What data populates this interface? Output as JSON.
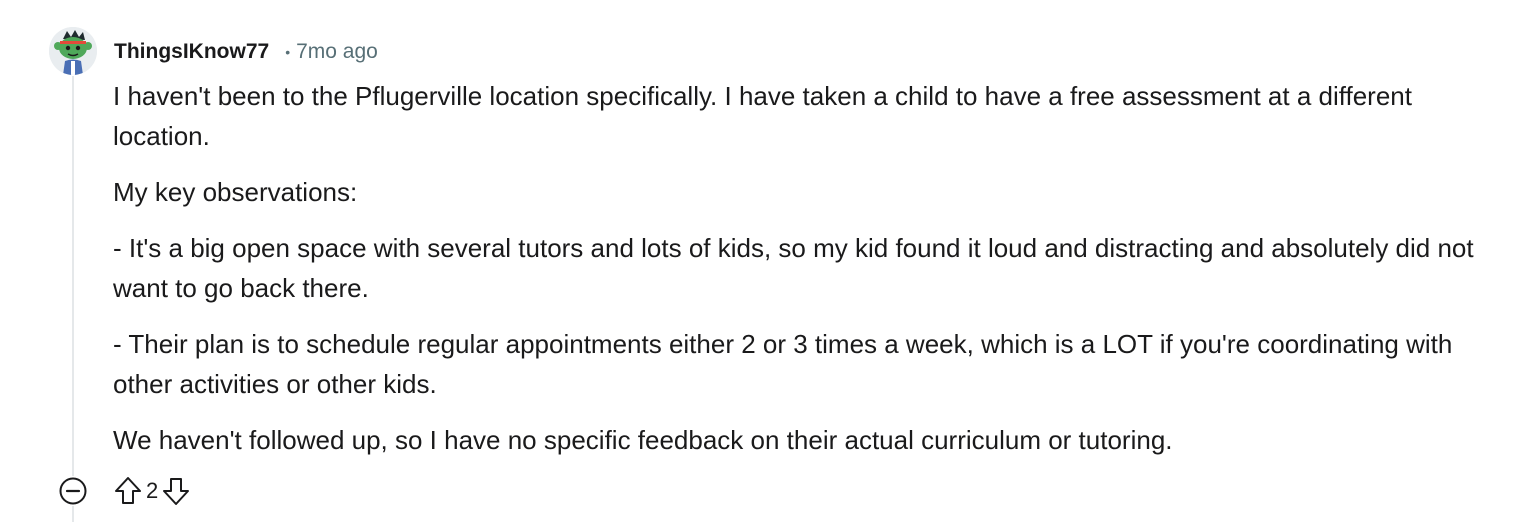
{
  "comment": {
    "author": "ThingsIKnow77",
    "separator": "•",
    "timestamp": "7mo ago",
    "paragraphs": [
      "I haven't been to the Pflugerville location specifically. I have taken a child to have a free assessment at a different location.",
      "My key observations:",
      "- It's a big open space with several tutors and lots of kids, so my kid found it loud and distracting and absolutely did not want to go back there.",
      "- Their plan is to schedule regular appointments either 2 or 3 times a week, which is a LOT if you're coordinating with other activities or other kids.",
      "We haven't followed up, so I have no specific feedback on their actual curriculum or tutoring."
    ],
    "score": "2"
  },
  "icons": {
    "avatar": "snoo-avatar",
    "collapse": "minus-circle-icon",
    "upvote": "arrow-up-icon",
    "downvote": "arrow-down-icon"
  },
  "colors": {
    "meta_text": "#576f76",
    "body_text": "#1a1a1b",
    "thread_line": "#e5e8ea",
    "avatar_green": "#4fa85a"
  }
}
